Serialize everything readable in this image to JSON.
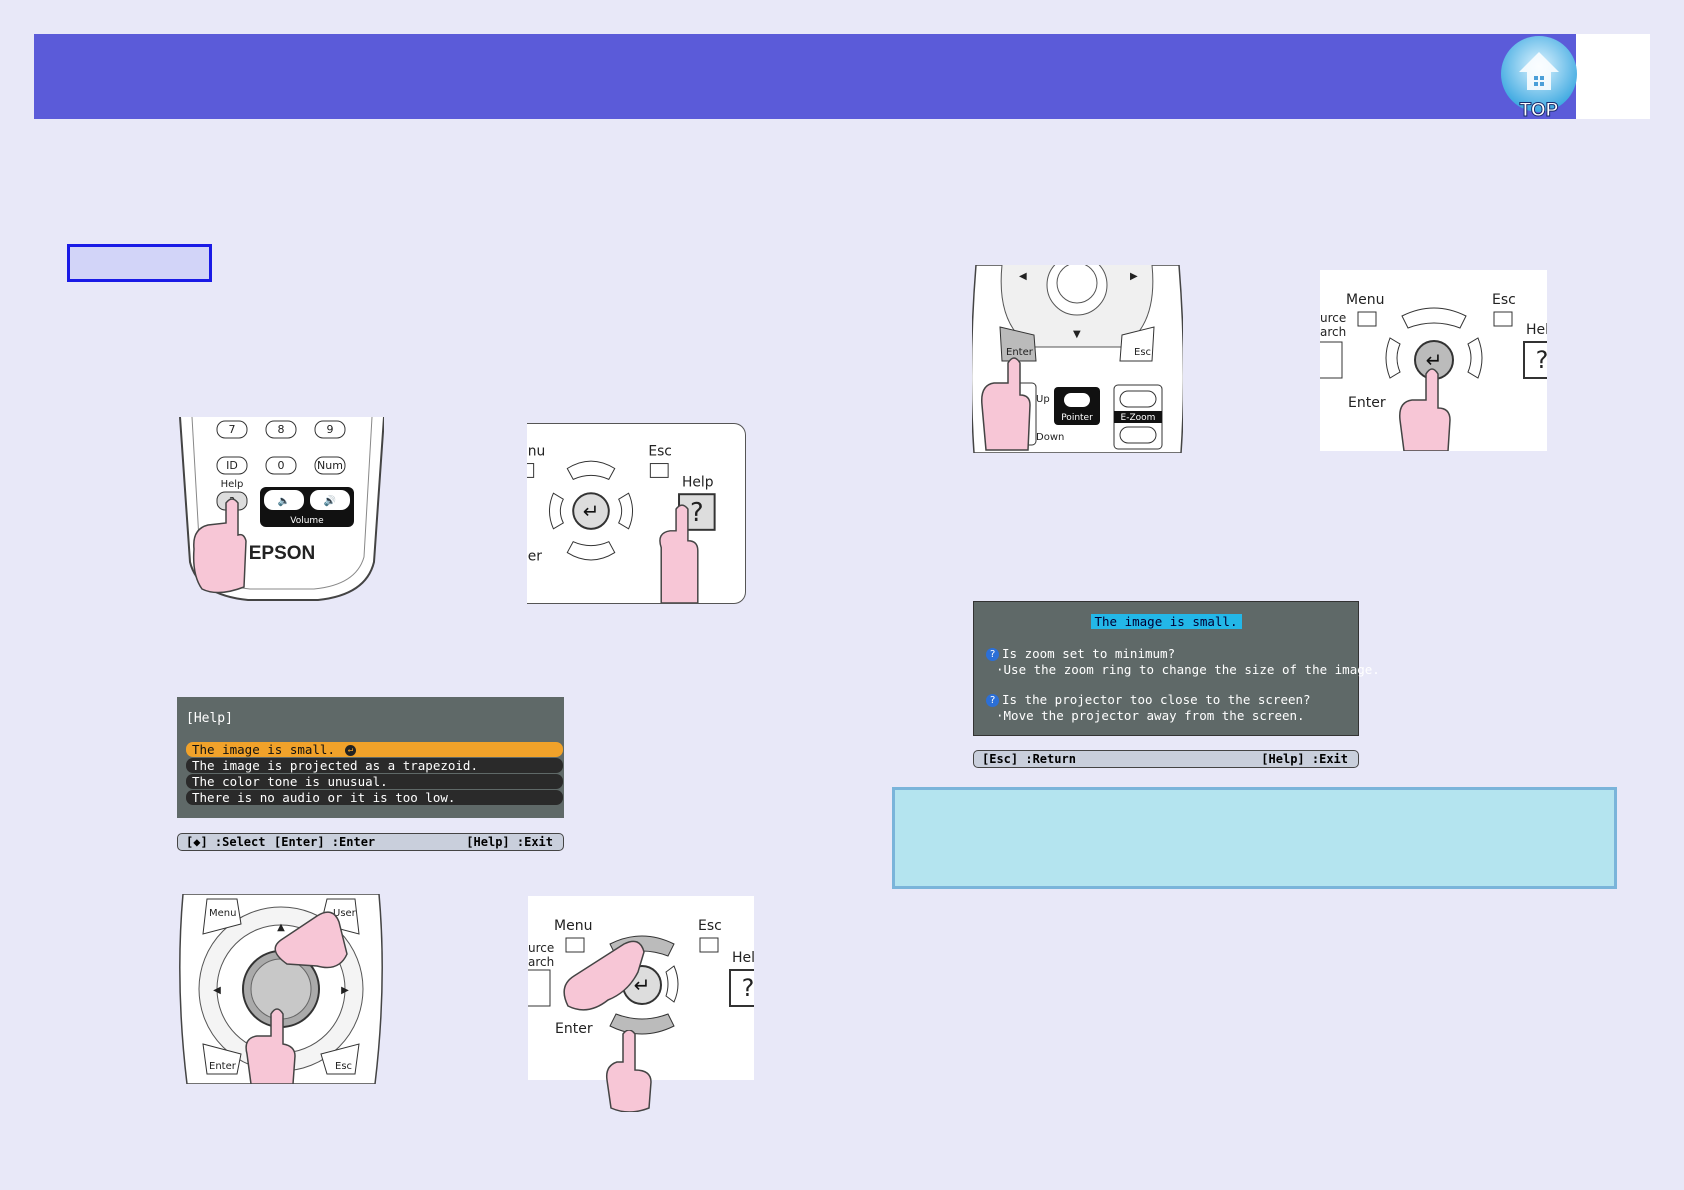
{
  "header": {
    "top_label": "TOP"
  },
  "remote_top_left": {
    "keys_row1": [
      "7",
      "8",
      "9"
    ],
    "keys_row2": [
      "ID",
      "0",
      "Num"
    ],
    "help_label": "Help",
    "help_symbol": "?",
    "volume_label": "Volume",
    "brand": "EPSON"
  },
  "panel_top_right": {
    "menu_label": "nu",
    "esc_label": "Esc",
    "help_label": "Help",
    "help_symbol": "?",
    "enter_label": "er"
  },
  "help_menu": {
    "title": "[Help]",
    "items": [
      "The image is small.",
      "The image is projected as a trapezoid.",
      "The color tone is unusual.",
      "There is no audio or it is too low."
    ],
    "footer_select": "[◆] :Select",
    "footer_enter": "[Enter] :Enter",
    "footer_exit": "[Help] :Exit"
  },
  "remote_bottom_left": {
    "menu_label": "Menu",
    "user_label": "User",
    "enter_label": "Enter",
    "esc_label": "Esc"
  },
  "panel_bottom_right": {
    "menu_label": "Menu",
    "esc_label": "Esc",
    "source_label1": "urce",
    "source_label2": "arch",
    "help_label": "Hel",
    "help_symbol": "?",
    "enter_label": "Enter"
  },
  "remote_right_top": {
    "enter_label": "Enter",
    "esc_label": "Esc",
    "up_label": "Up",
    "down_label": "Down",
    "pointer_label": "Pointer",
    "ezoom_label": "E-Zoom"
  },
  "panel_right_top": {
    "menu_label": "Menu",
    "esc_label": "Esc",
    "source_label1": "urce",
    "source_label2": "arch",
    "help_label": "Hel",
    "help_symbol": "?",
    "enter_label": "Enter"
  },
  "result_screen": {
    "title": "The image is small.",
    "q1": "Is zoom set to minimum?",
    "a1": "·Use the zoom ring to change the size of the image.",
    "q2": "Is the projector too close to the screen?",
    "a2": "·Move the projector away from the screen.",
    "footer_return": "[Esc] :Return",
    "footer_exit": "[Help] :Exit",
    "q_symbol": "?"
  },
  "colors": {
    "header": "#5b5bd9",
    "selected_row": "#f1a22a",
    "highlight": "#23b7e8",
    "finger": "#f7c6d6",
    "note_box": "#b4e4ef"
  }
}
